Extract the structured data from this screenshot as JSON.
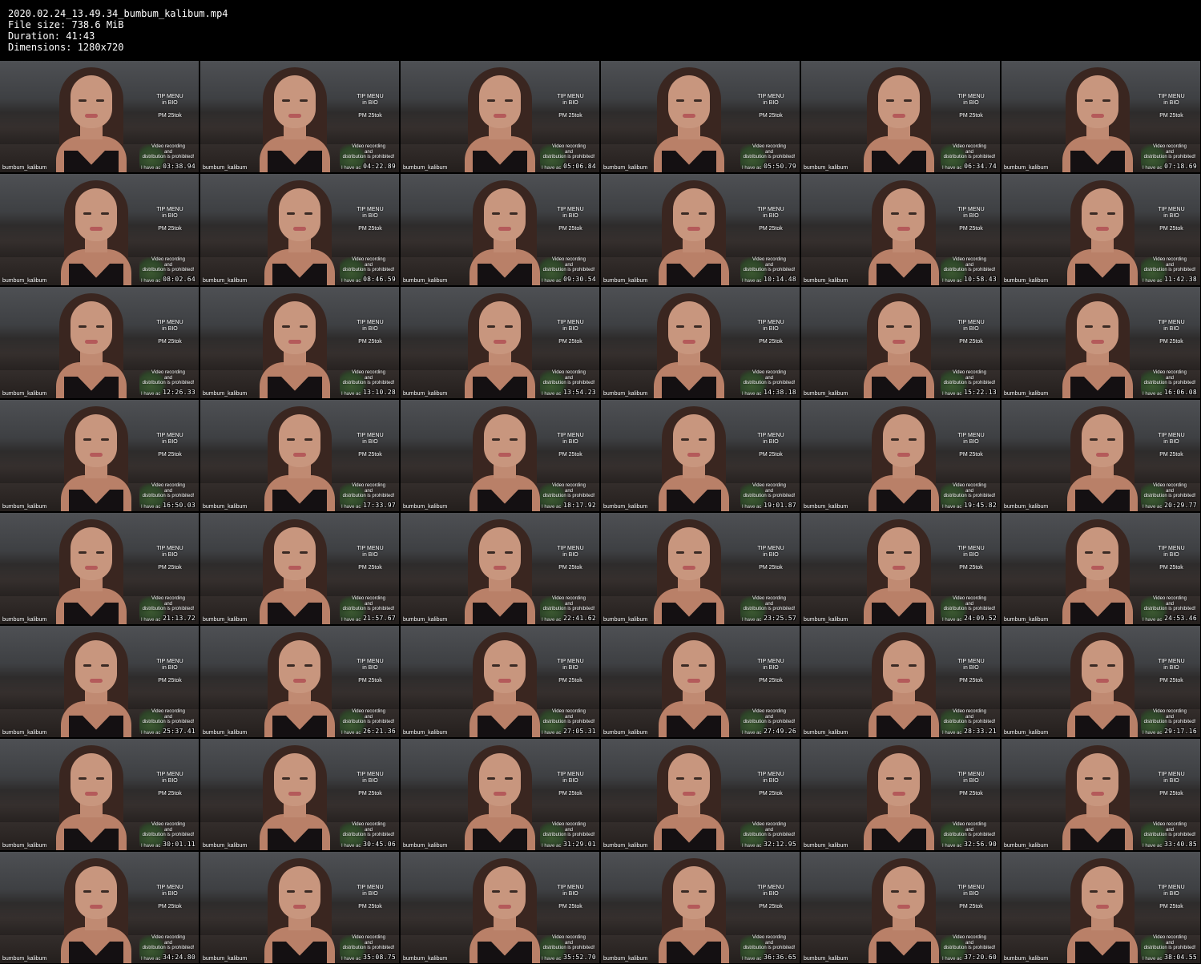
{
  "header": {
    "filename": "2020.02.24_13.49.34_bumbum_kalibum.mp4",
    "file_size": "File size: 738.6 MiB",
    "duration": "Duration: 41:43",
    "dimensions": "Dimensions: 1280x720"
  },
  "overlay": {
    "tip_menu": "TIP MENU",
    "in_bio": "in BIO",
    "pm": "PM 25tok",
    "video_recording": "Video recording",
    "and": "and",
    "distribution": "distribution is prohibited!",
    "have": "I have ac",
    "username": "bumbum_kalibum"
  },
  "thumbnails": [
    {
      "timestamp": "03:38.94"
    },
    {
      "timestamp": "04:22.89"
    },
    {
      "timestamp": "05:06.84"
    },
    {
      "timestamp": "05:50.79"
    },
    {
      "timestamp": "06:34.74"
    },
    {
      "timestamp": "07:18.69"
    },
    {
      "timestamp": "08:02.64"
    },
    {
      "timestamp": "08:46.59"
    },
    {
      "timestamp": "09:30.54"
    },
    {
      "timestamp": "10:14.48"
    },
    {
      "timestamp": "10:58.43"
    },
    {
      "timestamp": "11:42.38"
    },
    {
      "timestamp": "12:26.33"
    },
    {
      "timestamp": "13:10.28"
    },
    {
      "timestamp": "13:54.23"
    },
    {
      "timestamp": "14:38.18"
    },
    {
      "timestamp": "15:22.13"
    },
    {
      "timestamp": "16:06.08"
    },
    {
      "timestamp": "16:50.03"
    },
    {
      "timestamp": "17:33.97"
    },
    {
      "timestamp": "18:17.92"
    },
    {
      "timestamp": "19:01.87"
    },
    {
      "timestamp": "19:45.82"
    },
    {
      "timestamp": "20:29.77"
    },
    {
      "timestamp": "21:13.72"
    },
    {
      "timestamp": "21:57.67"
    },
    {
      "timestamp": "22:41.62"
    },
    {
      "timestamp": "23:25.57"
    },
    {
      "timestamp": "24:09.52"
    },
    {
      "timestamp": "24:53.46"
    },
    {
      "timestamp": "25:37.41"
    },
    {
      "timestamp": "26:21.36"
    },
    {
      "timestamp": "27:05.31"
    },
    {
      "timestamp": "27:49.26"
    },
    {
      "timestamp": "28:33.21"
    },
    {
      "timestamp": "29:17.16"
    },
    {
      "timestamp": "30:01.11"
    },
    {
      "timestamp": "30:45.06"
    },
    {
      "timestamp": "31:29.01"
    },
    {
      "timestamp": "32:12.95"
    },
    {
      "timestamp": "32:56.90"
    },
    {
      "timestamp": "33:40.85"
    },
    {
      "timestamp": "34:24.80"
    },
    {
      "timestamp": "35:08.75"
    },
    {
      "timestamp": "35:52.70"
    },
    {
      "timestamp": "36:36.65"
    },
    {
      "timestamp": "37:20.60"
    },
    {
      "timestamp": "38:04.55"
    }
  ]
}
